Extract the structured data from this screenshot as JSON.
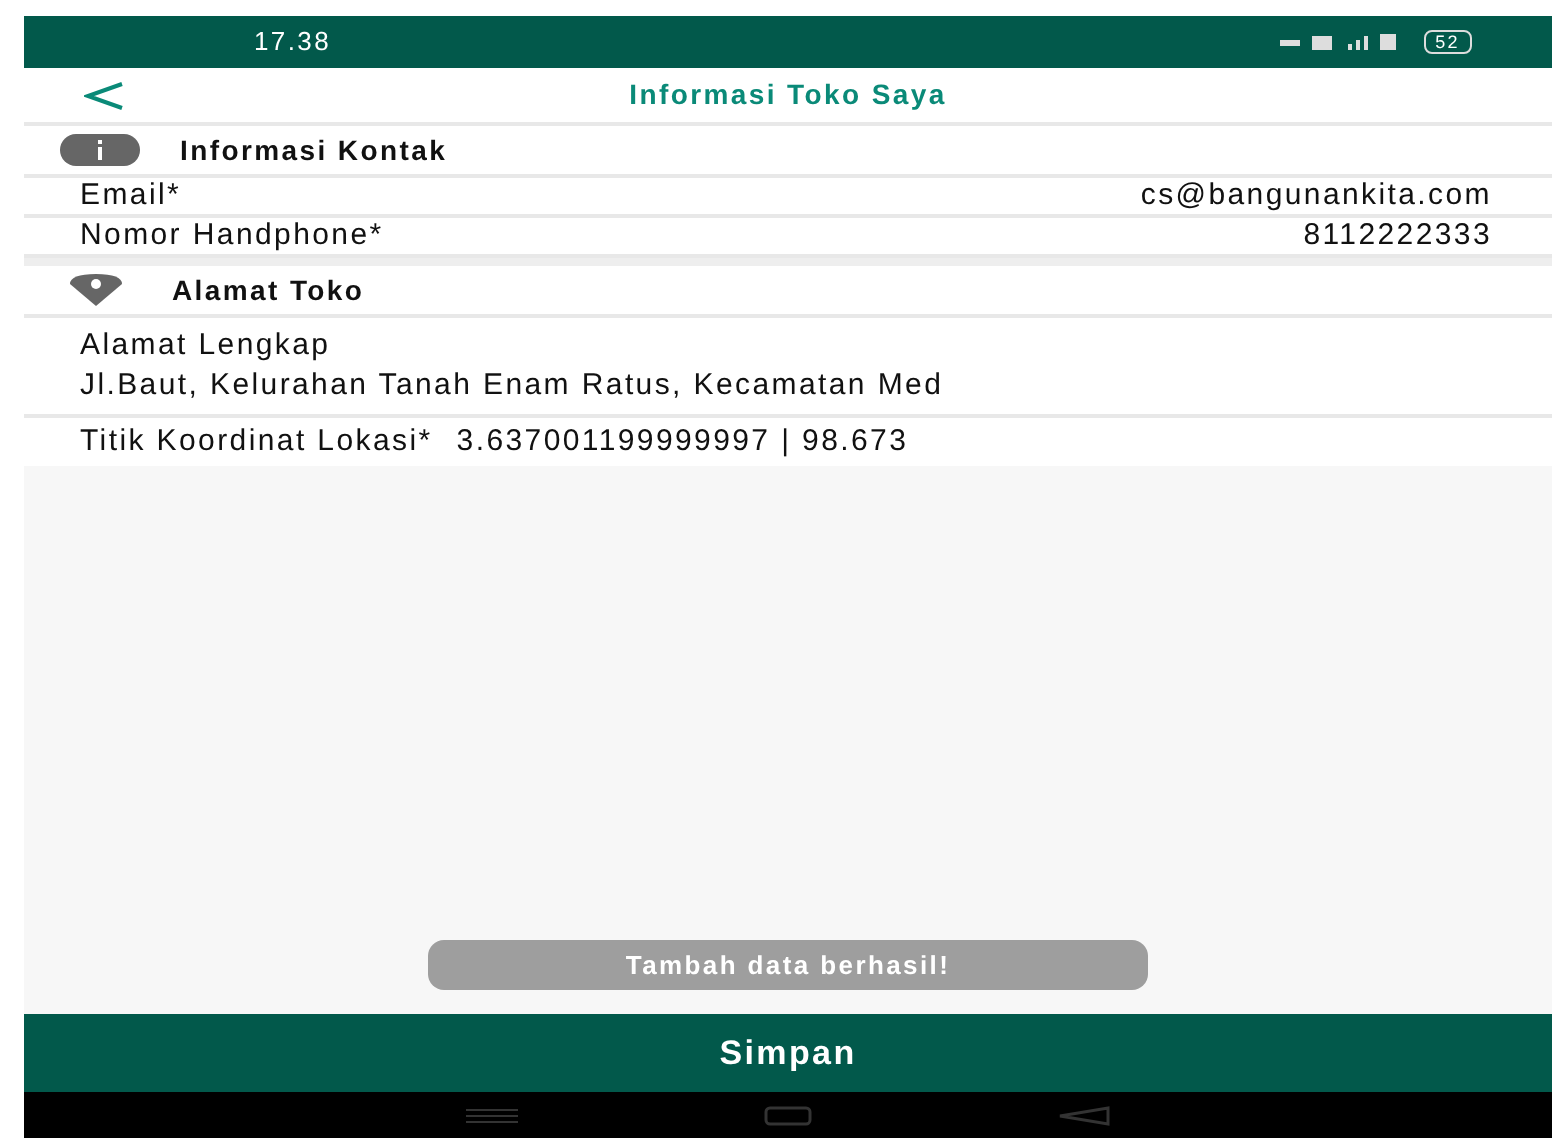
{
  "status_bar": {
    "time": "17.38",
    "battery": "52"
  },
  "header": {
    "title": "Informasi Toko Saya"
  },
  "sections": [
    {
      "title": "Informasi Kontak",
      "kind": "info",
      "rows": [
        {
          "kind": "pair",
          "label": "Email*",
          "value": "cs@bangunankita.com"
        },
        {
          "kind": "pair",
          "label": "Nomor Handphone*",
          "value": "8112222333"
        }
      ]
    },
    {
      "title": "Alamat Toko",
      "kind": "location",
      "rows": [
        {
          "kind": "stacked",
          "label": "Alamat Lengkap",
          "value": "Jl.Baut, Kelurahan Tanah Enam Ratus, Kecamatan Med"
        },
        {
          "kind": "inline",
          "label": "Titik Koordinat Lokasi*",
          "value": "3.637001199999997 | 98.673"
        }
      ]
    }
  ],
  "toast": "Tambah data berhasil!",
  "save_button": "Simpan"
}
